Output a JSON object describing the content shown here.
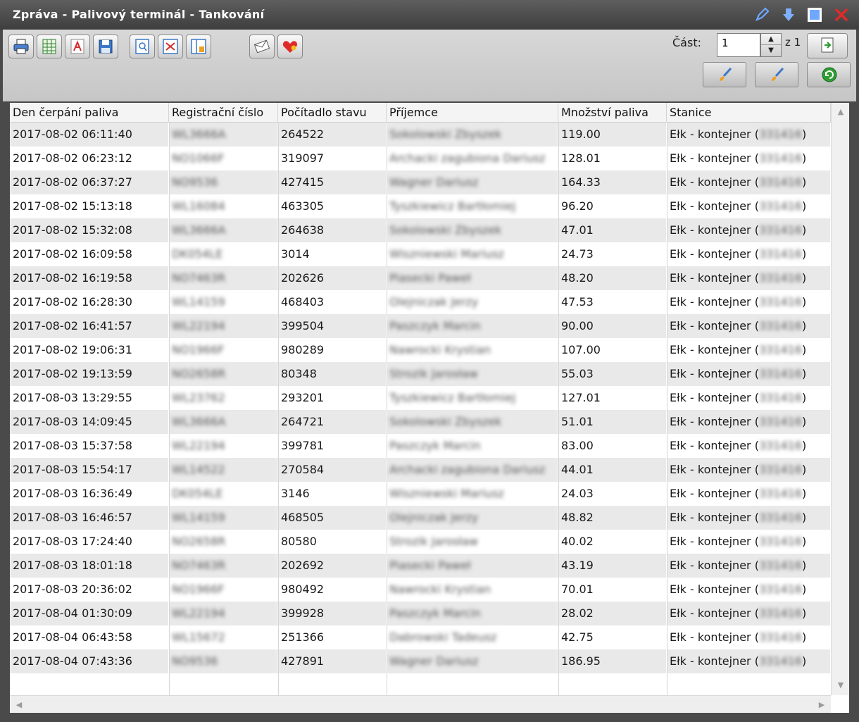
{
  "window": {
    "title": "Zpráva - Palivový terminál - Tankování",
    "controls": [
      "edit-icon",
      "download-icon",
      "maximize-icon",
      "close-icon"
    ]
  },
  "toolbar": {
    "buttons": [
      "print-icon",
      "excel-export-icon",
      "pdf-export-icon",
      "save-icon",
      "preview-icon",
      "fit-columns-icon",
      "layout-icon",
      "email-icon",
      "favorite-icon"
    ],
    "part_label": "Část:",
    "part_value": "1",
    "part_of": "z 1",
    "go_button": "go-icon",
    "action_buttons": [
      "brush-icon",
      "brush-icon",
      "refresh-icon"
    ]
  },
  "table": {
    "columns": [
      "Den čerpání paliva",
      "Registrační číslo",
      "Počítadlo stavu",
      "Příjemce",
      "Množství paliva",
      "Stanice"
    ],
    "rows": [
      [
        "2017-08-02 06:11:40",
        "WL3666A",
        "264522",
        "Sokolowski Zbyszek",
        "119.00",
        "Ełk - kontejner",
        "331416"
      ],
      [
        "2017-08-02 06:23:12",
        "NO1066F",
        "319097",
        "Archacki zagubiona Dariusz",
        "128.01",
        "Ełk - kontejner",
        "331416"
      ],
      [
        "2017-08-02 06:37:27",
        "NO9536",
        "427415",
        "Wagner Dariusz",
        "164.33",
        "Ełk - kontejner",
        "331416"
      ],
      [
        "2017-08-02 15:13:18",
        "WL16084",
        "463305",
        "Tyszkiewicz Bartłomiej",
        "96.20",
        "Ełk - kontejner",
        "331416"
      ],
      [
        "2017-08-02 15:32:08",
        "WL3666A",
        "264638",
        "Sokolowski Zbyszek",
        "47.01",
        "Ełk - kontejner",
        "331416"
      ],
      [
        "2017-08-02 16:09:58",
        "DK054LE",
        "3014",
        "Wiszniewski Mariusz",
        "24.73",
        "Ełk - kontejner",
        "331416"
      ],
      [
        "2017-08-02 16:19:58",
        "NO7463R",
        "202626",
        "Piasecki Paweł",
        "48.20",
        "Ełk - kontejner",
        "331416"
      ],
      [
        "2017-08-02 16:28:30",
        "WL14159",
        "468403",
        "Olejniczak Jerzy",
        "47.53",
        "Ełk - kontejner",
        "331416"
      ],
      [
        "2017-08-02 16:41:57",
        "WL22194",
        "399504",
        "Paszczyk Marcin",
        "90.00",
        "Ełk - kontejner",
        "331416"
      ],
      [
        "2017-08-02 19:06:31",
        "NO1966F",
        "980289",
        "Nawrocki Krystian",
        "107.00",
        "Ełk - kontejner",
        "331416"
      ],
      [
        "2017-08-02 19:13:59",
        "NO2658R",
        "80348",
        "Strozik Jarosław",
        "55.03",
        "Ełk - kontejner",
        "331416"
      ],
      [
        "2017-08-03 13:29:55",
        "WL23762",
        "293201",
        "Tyszkiewicz Bartłomiej",
        "127.01",
        "Ełk - kontejner",
        "331416"
      ],
      [
        "2017-08-03 14:09:45",
        "WL3666A",
        "264721",
        "Sokolowski Zbyszek",
        "51.01",
        "Ełk - kontejner",
        "331416"
      ],
      [
        "2017-08-03 15:37:58",
        "WL22194",
        "399781",
        "Paszczyk Marcin",
        "83.00",
        "Ełk - kontejner",
        "331416"
      ],
      [
        "2017-08-03 15:54:17",
        "WL14522",
        "270584",
        "Archacki zagubiona Dariusz",
        "44.01",
        "Ełk - kontejner",
        "331416"
      ],
      [
        "2017-08-03 16:36:49",
        "DK054LE",
        "3146",
        "Wiszniewski Mariusz",
        "24.03",
        "Ełk - kontejner",
        "331416"
      ],
      [
        "2017-08-03 16:46:57",
        "WL14159",
        "468505",
        "Olejniczak Jerzy",
        "48.82",
        "Ełk - kontejner",
        "331416"
      ],
      [
        "2017-08-03 17:24:40",
        "NO2658R",
        "80580",
        "Strozik Jarosław",
        "40.02",
        "Ełk - kontejner",
        "331416"
      ],
      [
        "2017-08-03 18:01:18",
        "NO7463R",
        "202692",
        "Piasecki Paweł",
        "43.19",
        "Ełk - kontejner",
        "331416"
      ],
      [
        "2017-08-03 20:36:02",
        "NO1966F",
        "980492",
        "Nawrocki Krystian",
        "70.01",
        "Ełk - kontejner",
        "331416"
      ],
      [
        "2017-08-04 01:30:09",
        "WL22194",
        "399928",
        "Paszczyk Marcin",
        "28.02",
        "Ełk - kontejner",
        "331416"
      ],
      [
        "2017-08-04 06:43:58",
        "WL15672",
        "251366",
        "Dabrowski Tadeusz",
        "42.75",
        "Ełk - kontejner",
        "331416"
      ],
      [
        "2017-08-04 07:43:36",
        "NO9536",
        "427891",
        "Wagner Dariusz",
        "186.95",
        "Ełk - kontejner",
        "331416"
      ]
    ]
  }
}
